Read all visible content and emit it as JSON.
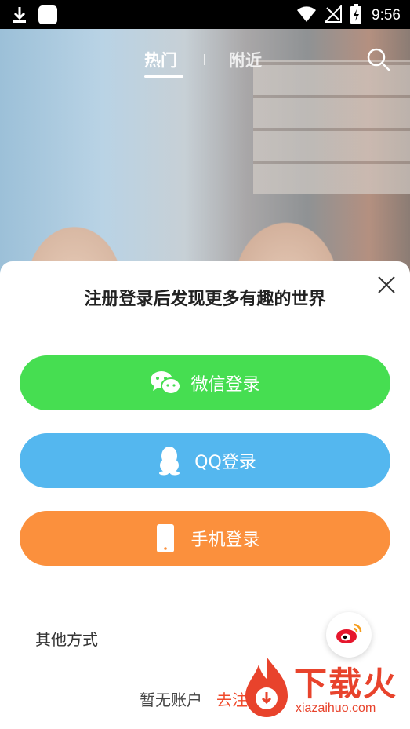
{
  "status_bar": {
    "time": "9:56"
  },
  "nav": {
    "tab_hot": "热门",
    "tab_nearby": "附近"
  },
  "sheet": {
    "title": "注册登录后发现更多有趣的世界",
    "wechat_label": "微信登录",
    "qq_label": "QQ登录",
    "phone_label": "手机登录",
    "other_label": "其他方式",
    "no_account": "暂无账户",
    "register": "去注册"
  },
  "watermark": {
    "brand": "下载火",
    "site": "xiazaihuo.com"
  },
  "colors": {
    "wechat": "#46de51",
    "qq": "#54b7ef",
    "phone": "#fb903d",
    "register": "#f04a2b"
  }
}
